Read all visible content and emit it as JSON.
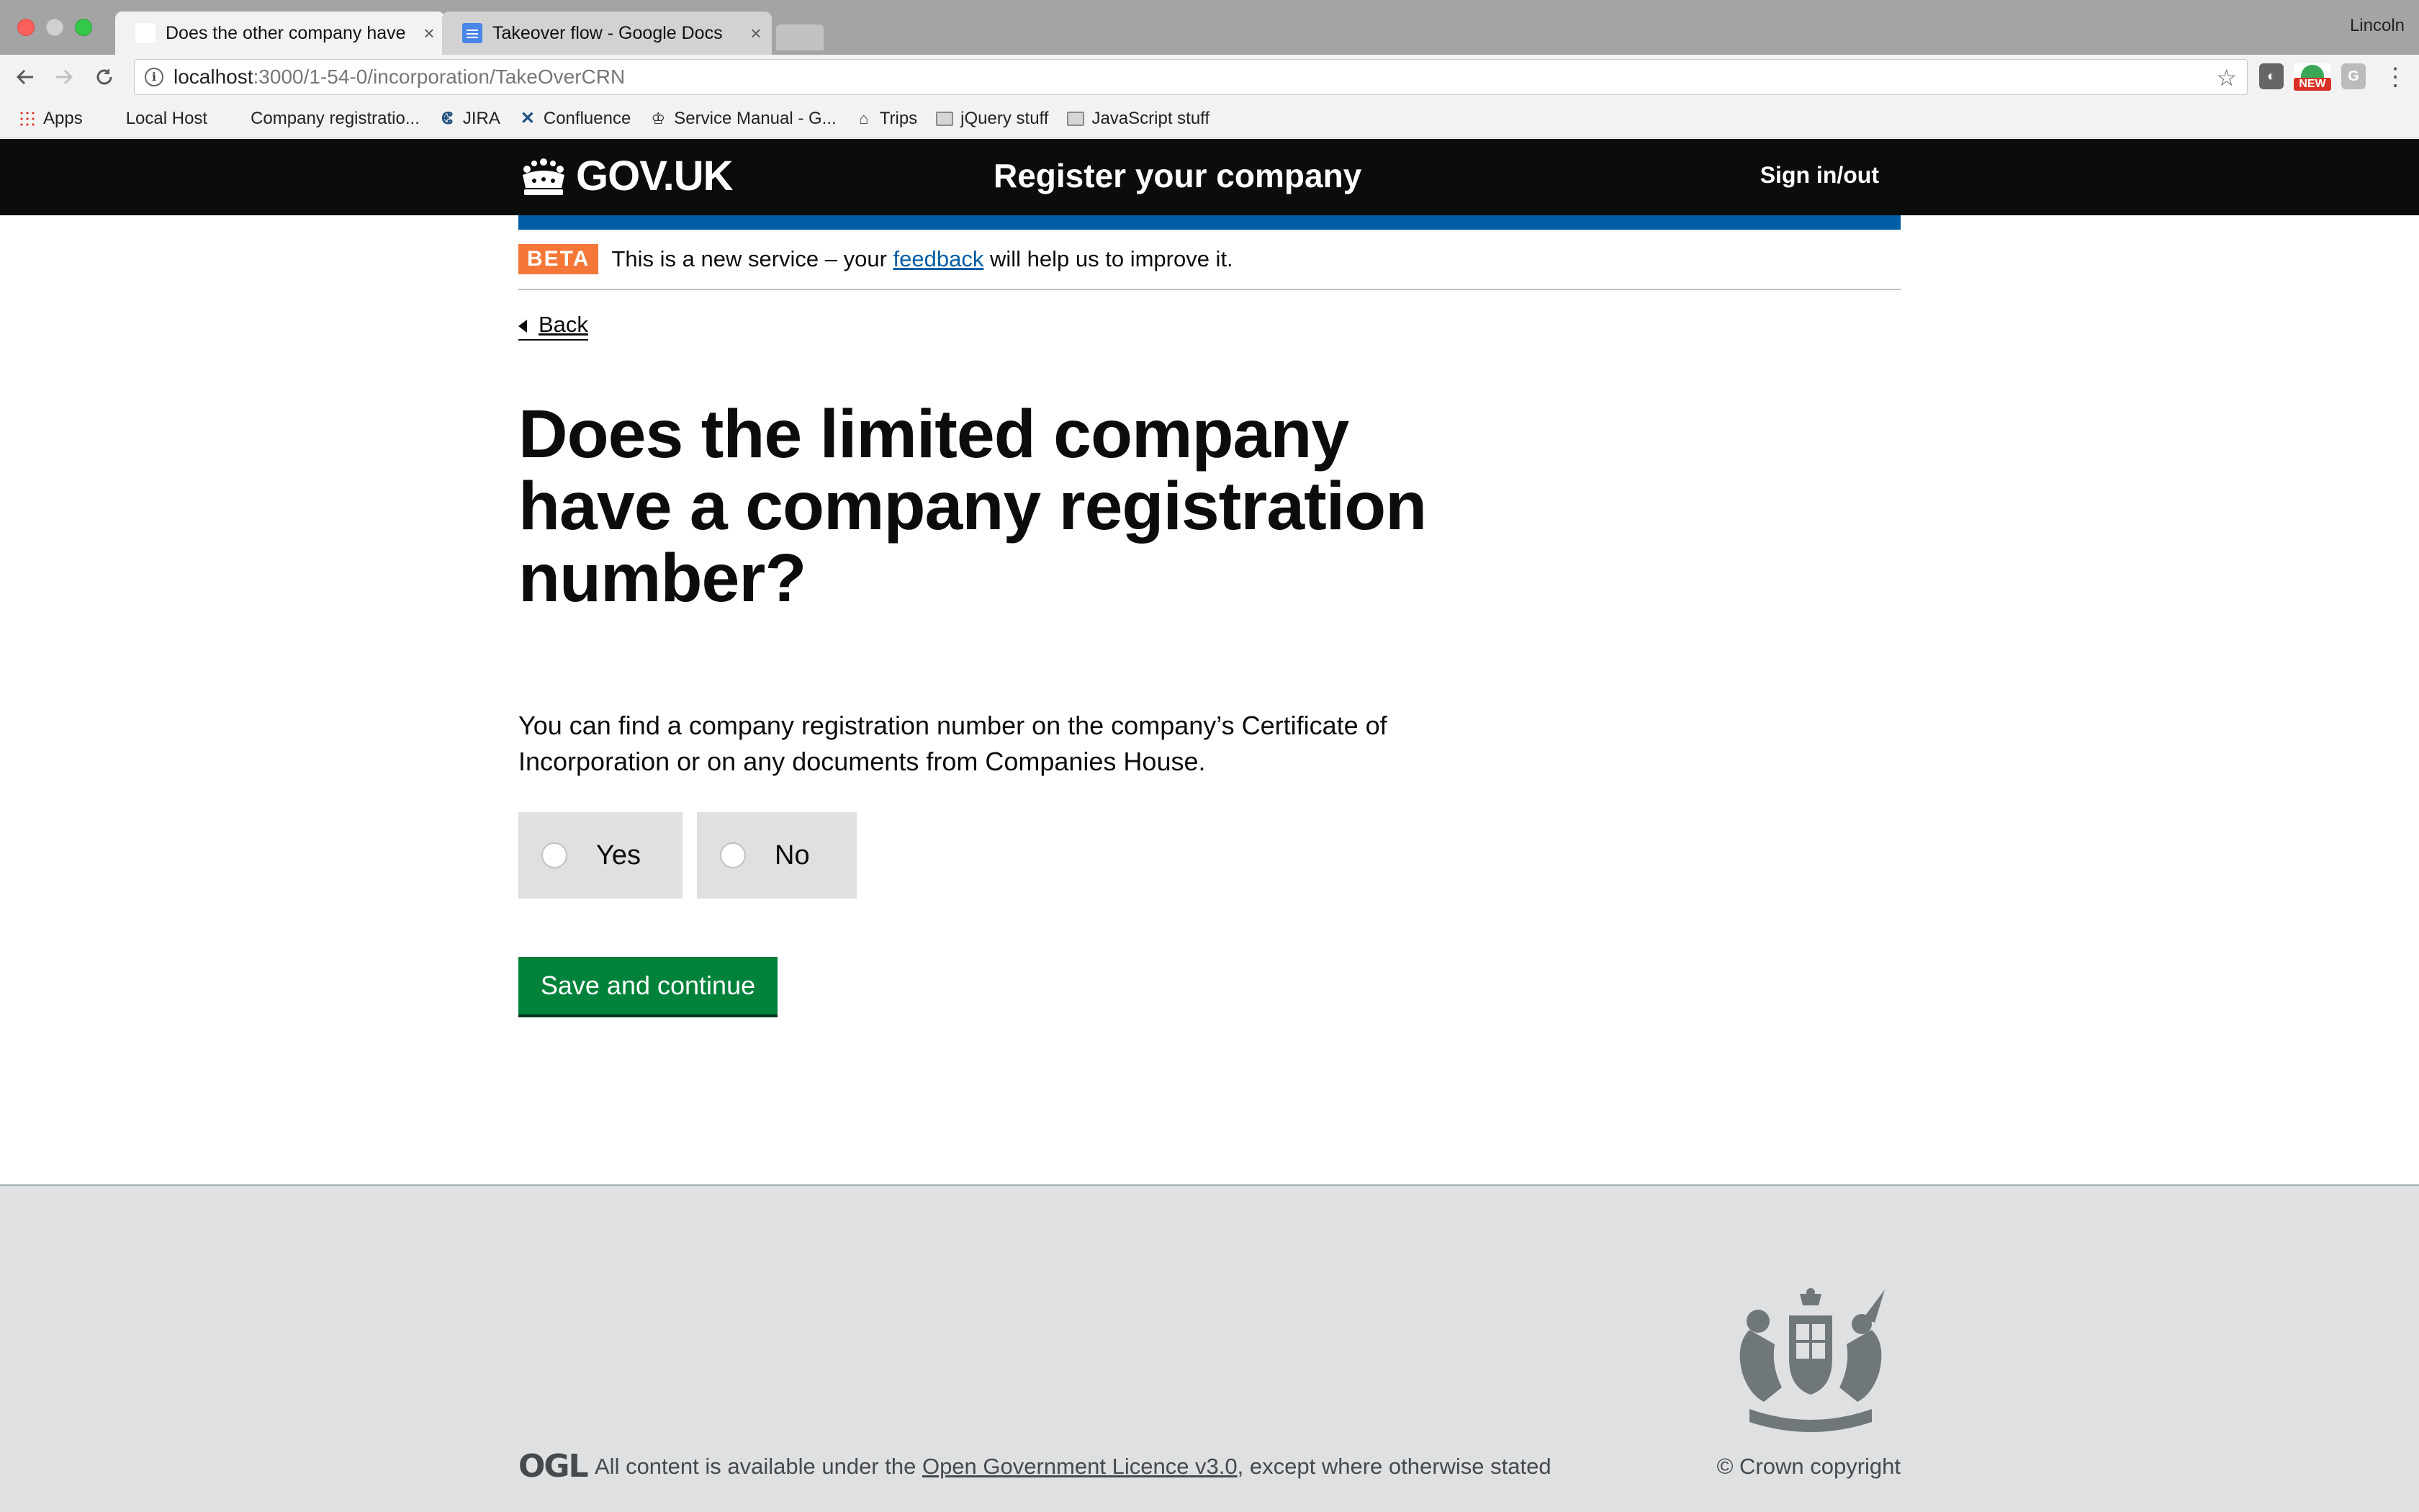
{
  "browser": {
    "tabs": [
      {
        "title": "Does the other company have",
        "close": "×"
      },
      {
        "title": "Takeover flow - Google Docs",
        "close": "×"
      }
    ],
    "profile_name": "Lincoln",
    "url_host": "localhost",
    "url_rest": ":3000/1-54-0/incorporation/TakeOverCRN",
    "bookmarks": [
      {
        "label": "Apps",
        "icon": "apps-grid-icon"
      },
      {
        "label": "Local Host",
        "icon": "blank-page-icon"
      },
      {
        "label": "Company registratio...",
        "icon": "blank-page-icon"
      },
      {
        "label": "JIRA",
        "icon": "jira-icon"
      },
      {
        "label": "Confluence",
        "icon": "confluence-icon"
      },
      {
        "label": "Service Manual - G...",
        "icon": "crown-icon"
      },
      {
        "label": "Trips",
        "icon": "trips-icon"
      },
      {
        "label": "jQuery stuff",
        "icon": "folder-icon"
      },
      {
        "label": "JavaScript stuff",
        "icon": "folder-icon"
      }
    ],
    "extension_badge": "NEW",
    "extension_g": "G"
  },
  "header": {
    "logo_text": "GOV.UK",
    "service_name": "Register your company",
    "sign_in": "Sign in/out"
  },
  "phase_banner": {
    "tag": "BETA",
    "text_before": "This is a new service – your ",
    "link_text": "feedback",
    "text_after": " will help us to improve it."
  },
  "back_link": "Back",
  "question": {
    "heading": "Does the limited company have a company registration number?",
    "hint": "You can find a company registration number on the company’s Certificate of Incorporation or on any documents from Companies House.",
    "options": [
      "Yes",
      "No"
    ]
  },
  "submit_label": "Save and continue",
  "footer": {
    "ogl": "OGL",
    "licence_before": "All content is available under the ",
    "licence_link": "Open Government Licence v3.0",
    "licence_after": ", except where otherwise stated",
    "copyright": "© Crown copyright"
  },
  "colors": {
    "header_bg": "#0b0c0c",
    "brand_blue": "#005ea5",
    "beta_orange": "#f47738",
    "button_green": "#00823b",
    "footer_bg": "#dee0e2"
  }
}
